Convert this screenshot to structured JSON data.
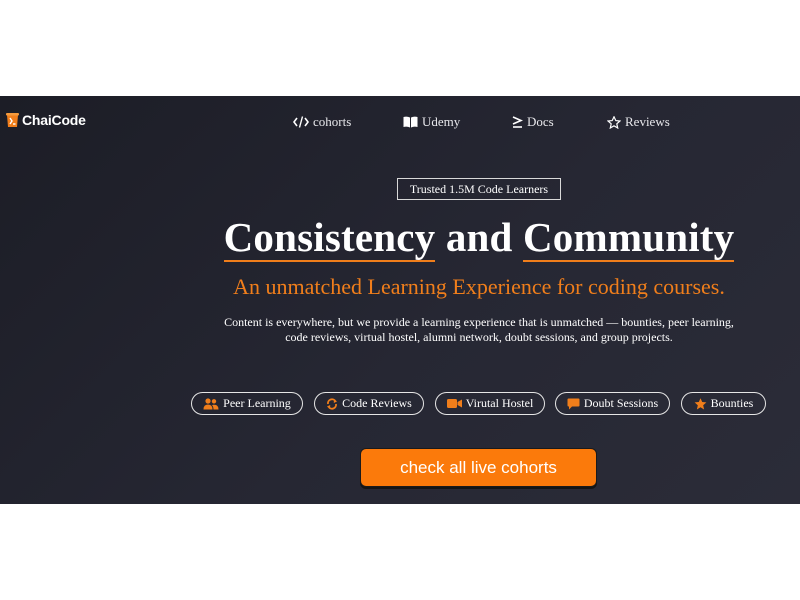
{
  "brand": {
    "name": "ChaiCode",
    "accent": "#f07e1b"
  },
  "nav": [
    {
      "label": "cohorts",
      "icon": "code-icon"
    },
    {
      "label": "Udemy",
      "icon": "book-open-icon"
    },
    {
      "label": "Docs",
      "icon": "greater-equal-icon"
    },
    {
      "label": "Reviews",
      "icon": "star-outline-icon"
    }
  ],
  "hero": {
    "badge": "Trusted 1.5M Code Learners",
    "headline_1": "Consistency",
    "headline_and": "and",
    "headline_2": "Community",
    "subheadline": "An unmatched Learning Experience for coding courses.",
    "description": "Content is everywhere, but we provide a learning experience that is unmatched — bounties, peer learning, code reviews, virtual hostel, alumni network, doubt sessions, and group projects."
  },
  "features": [
    {
      "label": "Peer Learning",
      "icon": "users-icon"
    },
    {
      "label": "Code Reviews",
      "icon": "refresh-icon"
    },
    {
      "label": "Virutal Hostel",
      "icon": "video-icon"
    },
    {
      "label": "Doubt Sessions",
      "icon": "chat-icon"
    },
    {
      "label": "Bounties",
      "icon": "star-icon"
    }
  ],
  "cta": {
    "label": "check all live cohorts",
    "color": "#fb7a0b"
  },
  "colors": {
    "background": "#23242f",
    "text": "#ffffff"
  }
}
